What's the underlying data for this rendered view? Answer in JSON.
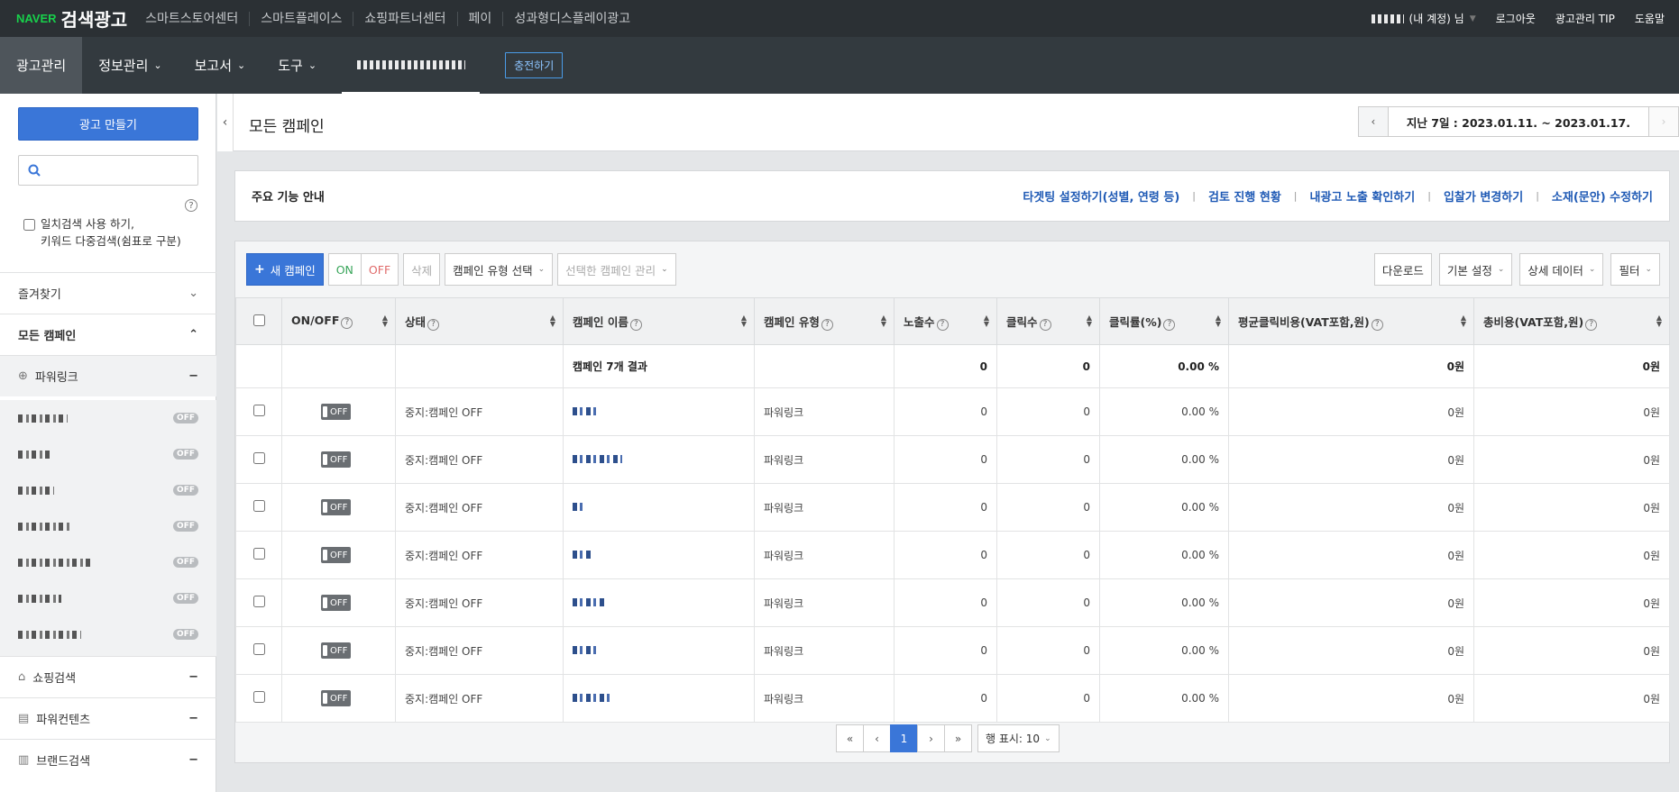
{
  "topbar": {
    "brand": "NAVER",
    "title": "검색광고",
    "links": [
      "스마트스토어센터",
      "스마트플레이스",
      "쇼핑파트너센터",
      "페이",
      "성과형디스플레이광고"
    ],
    "account_label": "(내 계정) 님",
    "logout": "로그아웃",
    "tip": "광고관리 TIP",
    "help": "도움말"
  },
  "nav": {
    "items": [
      "광고관리",
      "정보관리",
      "보고서",
      "도구"
    ],
    "charge": "충전하기"
  },
  "sidebar": {
    "create_button": "광고 만들기",
    "search_placeholder": "",
    "exact_line1": "일치검색 사용 하기,",
    "exact_line2": "키워드 다중검색(쉼표로 구분)",
    "favorites": "즐겨찾기",
    "all_campaigns": "모든 캠페인",
    "powerlink": "파워링크",
    "off_badge": "OFF",
    "shopping": "쇼핑검색",
    "powercontents": "파워컨텐츠",
    "brand": "브랜드검색"
  },
  "page": {
    "title": "모든 캠페인",
    "date_range": "지난 7일 : 2023.01.11. ~ 2023.01.17."
  },
  "guide": {
    "title": "주요 기능 안내",
    "links": [
      "타겟팅 설정하기(성별, 연령 등)",
      "검토 진행 현황",
      "내광고 노출 확인하기",
      "입찰가 변경하기",
      "소재(문안) 수정하기"
    ]
  },
  "toolbar": {
    "new_campaign": "새 캠페인",
    "on": "ON",
    "off": "OFF",
    "delete": "삭제",
    "type_select": "캠페인 유형 선택",
    "manage_selected": "선택한 캠페인 관리",
    "download": "다운로드",
    "basic_settings": "기본 설정",
    "detail_data": "상세 데이터",
    "filter": "필터"
  },
  "table": {
    "headers": [
      "ON/OFF",
      "상태",
      "캠페인 이름",
      "캠페인 유형",
      "노출수",
      "클릭수",
      "클릭률(%)",
      "평균클릭비용(VAT포함,원)",
      "총비용(VAT포함,원)"
    ],
    "summary": {
      "name": "캠페인 7개 결과",
      "impressions": "0",
      "clicks": "0",
      "ctr": "0.00 %",
      "cpc": "0원",
      "cost": "0원"
    },
    "rows": [
      {
        "toggle": "OFF",
        "status": "중지:캠페인 OFF",
        "type": "파워링크",
        "impressions": "0",
        "clicks": "0",
        "ctr": "0.00 %",
        "cpc": "0원",
        "cost": "0원"
      },
      {
        "toggle": "OFF",
        "status": "중지:캠페인 OFF",
        "type": "파워링크",
        "impressions": "0",
        "clicks": "0",
        "ctr": "0.00 %",
        "cpc": "0원",
        "cost": "0원"
      },
      {
        "toggle": "OFF",
        "status": "중지:캠페인 OFF",
        "type": "파워링크",
        "impressions": "0",
        "clicks": "0",
        "ctr": "0.00 %",
        "cpc": "0원",
        "cost": "0원"
      },
      {
        "toggle": "OFF",
        "status": "중지:캠페인 OFF",
        "type": "파워링크",
        "impressions": "0",
        "clicks": "0",
        "ctr": "0.00 %",
        "cpc": "0원",
        "cost": "0원"
      },
      {
        "toggle": "OFF",
        "status": "중지:캠페인 OFF",
        "type": "파워링크",
        "impressions": "0",
        "clicks": "0",
        "ctr": "0.00 %",
        "cpc": "0원",
        "cost": "0원"
      },
      {
        "toggle": "OFF",
        "status": "중지:캠페인 OFF",
        "type": "파워링크",
        "impressions": "0",
        "clicks": "0",
        "ctr": "0.00 %",
        "cpc": "0원",
        "cost": "0원"
      },
      {
        "toggle": "OFF",
        "status": "중지:캠페인 OFF",
        "type": "파워링크",
        "impressions": "0",
        "clicks": "0",
        "ctr": "0.00 %",
        "cpc": "0원",
        "cost": "0원"
      }
    ]
  },
  "pager": {
    "first": "«",
    "prev": "‹",
    "current": "1",
    "next": "›",
    "last": "»",
    "rows_label": "행 표시: 10"
  },
  "colors": {
    "accent": "#3a76d8",
    "topbar": "#2b3034",
    "navbar": "#333a3f",
    "brand_green": "#18d04b",
    "link_blue": "#1f5ab5"
  }
}
